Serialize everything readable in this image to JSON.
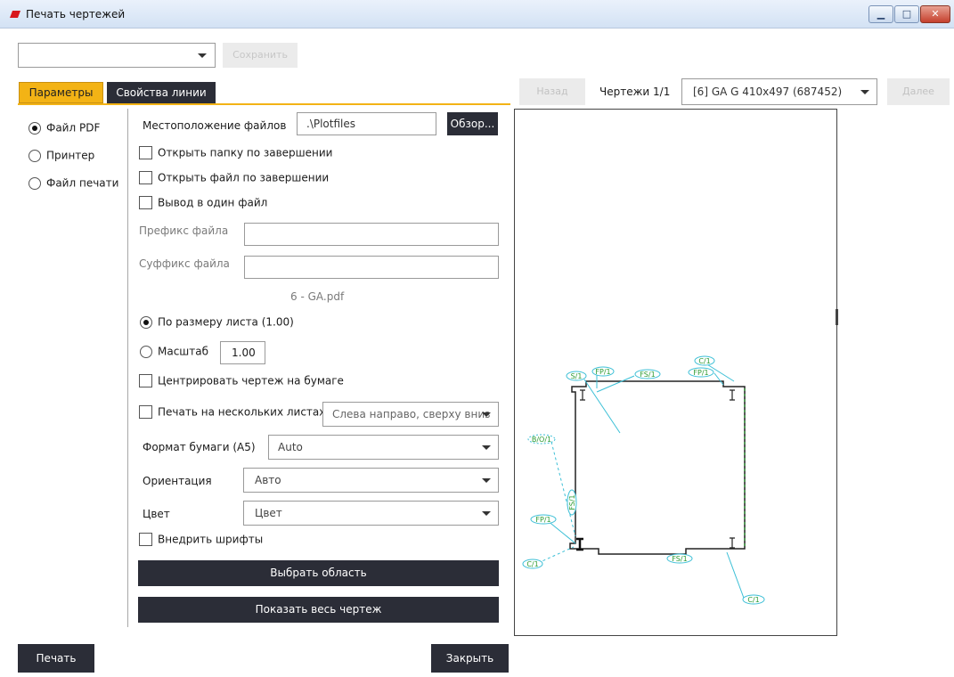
{
  "window": {
    "title": "Печать чертежей"
  },
  "top": {
    "preset_value": "",
    "save_label": "Сохранить"
  },
  "tabs": [
    {
      "label": "Параметры"
    },
    {
      "label": "Свойства линии"
    }
  ],
  "output_types": [
    {
      "label": "Файл PDF",
      "selected": true
    },
    {
      "label": "Принтер",
      "selected": false
    },
    {
      "label": "Файл печати",
      "selected": false
    }
  ],
  "params": {
    "location_label": "Местоположение файлов",
    "location_value": ".\\Plotfiles",
    "browse_label": "Обзор...",
    "open_folder_label": "Открыть папку по завершении",
    "open_file_label": "Открыть файл по завершении",
    "single_file_label": "Вывод в один файл",
    "prefix_label": "Префикс файла",
    "prefix_value": "",
    "suffix_label": "Суффикс файла",
    "suffix_value": "",
    "filename_preview": "6 - GA.pdf",
    "fit_label": "По размеру листа (1.00)",
    "scale_label": "Масштаб",
    "scale_value": "1.00",
    "center_label": "Центрировать чертеж на бумаге",
    "multi_label": "Печать на нескольких листах",
    "multi_order_value": "Слева направо, сверху вниз",
    "paper_label": "Формат бумаги (A5)",
    "paper_value": "Auto",
    "orientation_label": "Ориентация",
    "orientation_value": "Авто",
    "color_label": "Цвет",
    "color_value": "Цвет",
    "embed_fonts_label": "Внедрить шрифты",
    "select_area_label": "Выбрать область",
    "show_all_label": "Показать весь чертеж"
  },
  "preview": {
    "back_label": "Назад",
    "count_label": "Чертежи 1/1",
    "sheet_value": "[6] GA G 410x497 (687452)",
    "next_label": "Далее",
    "tags": {
      "s": "S/1",
      "fp": "FP/1",
      "fs": "FS/1",
      "c": "C/1",
      "bo": "B/O/1"
    }
  },
  "bottom": {
    "print_label": "Печать",
    "close_label": "Закрыть"
  },
  "colors": {
    "accent": "#f3b315",
    "dark_button": "#2b2d37",
    "drawing_line": "#3bbfd6",
    "tag_text": "#2a9a30"
  }
}
